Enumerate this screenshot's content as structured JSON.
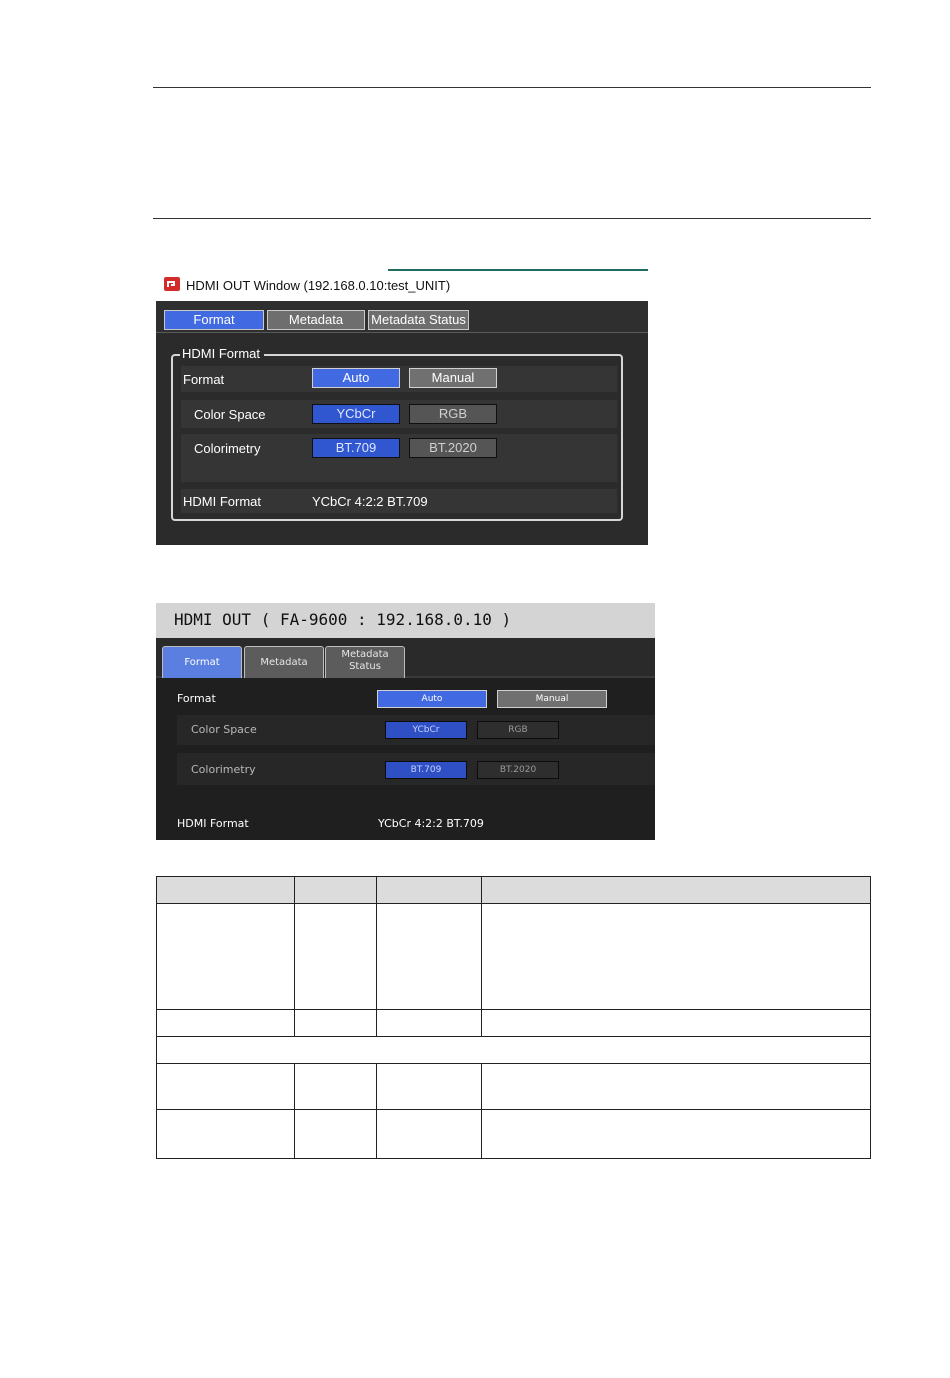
{
  "window1": {
    "title": "HDMI OUT Window (192.168.0.10:test_UNIT)",
    "tabs": [
      {
        "label": "Format",
        "active": true
      },
      {
        "label": "Metadata",
        "active": false
      },
      {
        "label": "Metadata Status",
        "active": false
      }
    ],
    "group_title": "HDMI Format",
    "format": {
      "label": "Format",
      "options": [
        "Auto",
        "Manual"
      ],
      "selected": "Auto"
    },
    "color_space": {
      "label": "Color Space",
      "options": [
        "YCbCr",
        "RGB"
      ],
      "selected": "YCbCr"
    },
    "colorimetry": {
      "label": "Colorimetry",
      "options": [
        "BT.709",
        "BT.2020"
      ],
      "selected": "BT.709"
    },
    "hdmi_format": {
      "label": "HDMI Format",
      "value": "YCbCr 4:2:2 BT.709"
    }
  },
  "window2": {
    "title": "HDMI OUT ( FA-9600 : 192.168.0.10 )",
    "tabs": [
      {
        "label": "Format",
        "active": true
      },
      {
        "label": "Metadata",
        "active": false
      },
      {
        "label": "Metadata\nStatus",
        "active": false
      }
    ],
    "format": {
      "label": "Format",
      "options": [
        "Auto",
        "Manual"
      ],
      "selected": "Auto"
    },
    "color_space": {
      "label": "Color Space",
      "options": [
        "YCbCr",
        "RGB"
      ],
      "selected": "YCbCr"
    },
    "colorimetry": {
      "label": "Colorimetry",
      "options": [
        "BT.709",
        "BT.2020"
      ],
      "selected": "BT.709"
    },
    "hdmi_format": {
      "label": "HDMI Format",
      "value": "YCbCr 4:2:2 BT.709"
    }
  },
  "colors": {
    "accent_blue": "#4169e1",
    "button_gray": "#707070",
    "title_accent": "#1f6b5f",
    "icon_red": "#d42a2a"
  },
  "icons": {
    "app_icon": "app-icon"
  }
}
